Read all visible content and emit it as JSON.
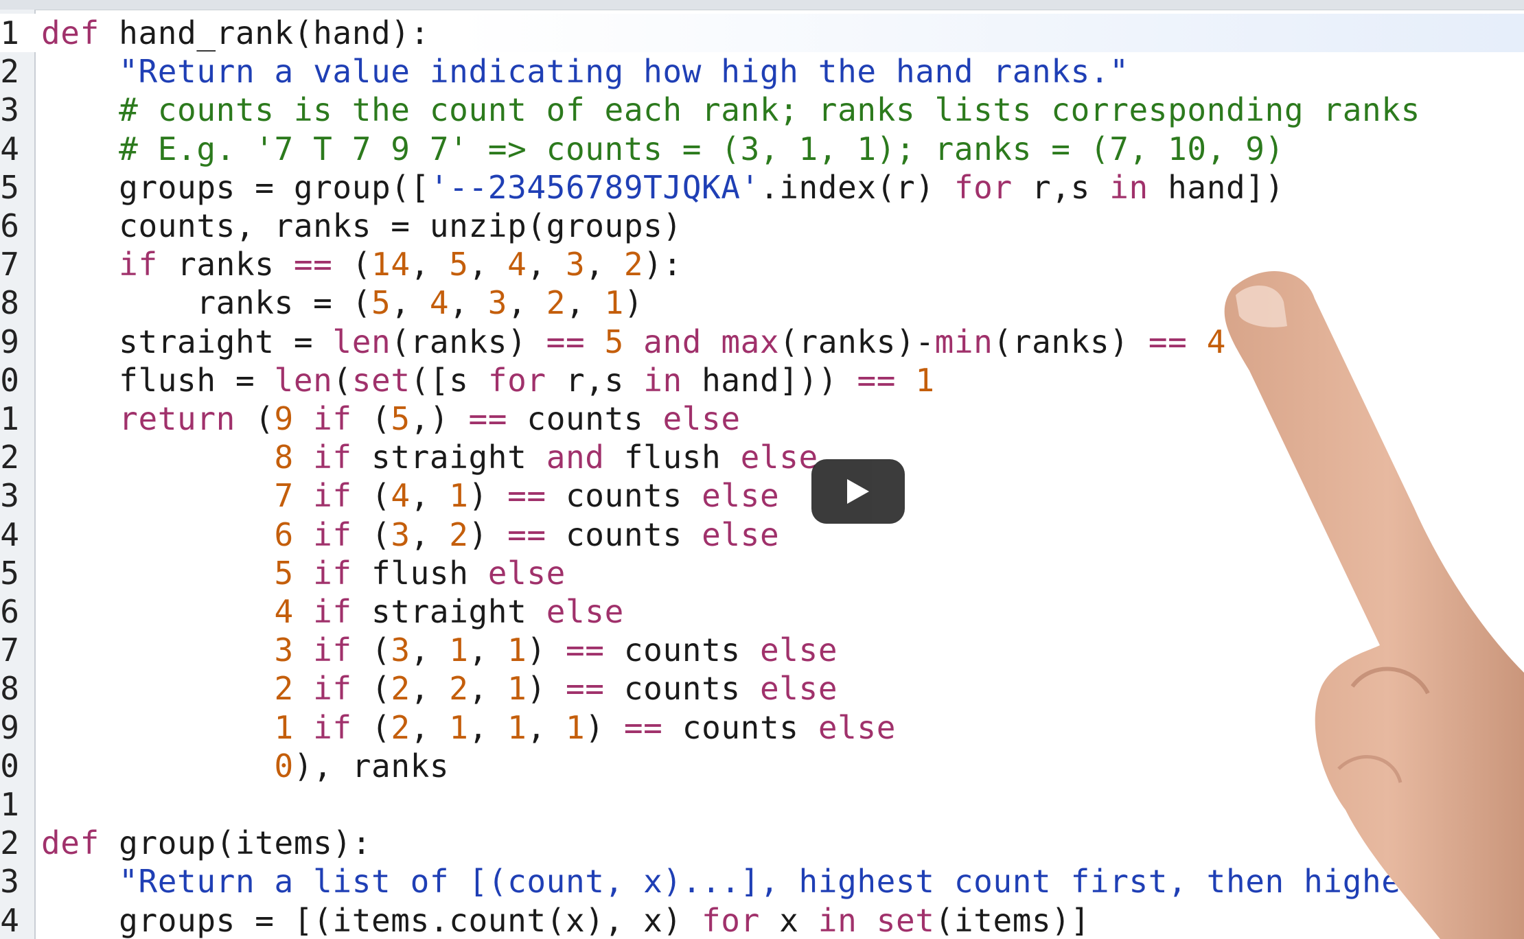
{
  "video": {
    "play_label": "play"
  },
  "colors": {
    "keyword": "#a0316b",
    "string": "#1f3fb5",
    "comment": "#2c7a1d",
    "number": "#c45e0b"
  },
  "lines": [
    {
      "n": "1",
      "tokens": [
        [
          "k",
          "def"
        ],
        [
          "b",
          " hand_rank(hand):"
        ]
      ]
    },
    {
      "n": "2",
      "tokens": [
        [
          "s",
          "    \"Return a value indicating how high the hand ranks.\""
        ]
      ]
    },
    {
      "n": "3",
      "tokens": [
        [
          "c",
          "    # counts is the count of each rank; ranks lists corresponding ranks"
        ]
      ]
    },
    {
      "n": "4",
      "tokens": [
        [
          "c",
          "    # E.g. '7 T 7 9 7' => counts = (3, 1, 1); ranks = (7, 10, 9)"
        ]
      ]
    },
    {
      "n": "5",
      "tokens": [
        [
          "b",
          "    groups = group(["
        ],
        [
          "s",
          "'--23456789TJQKA'"
        ],
        [
          "b",
          ".index(r) "
        ],
        [
          "k",
          "for"
        ],
        [
          "b",
          " r,s "
        ],
        [
          "k",
          "in"
        ],
        [
          "b",
          " hand])"
        ]
      ]
    },
    {
      "n": "6",
      "tokens": [
        [
          "b",
          "    counts, ranks = unzip(groups)"
        ]
      ]
    },
    {
      "n": "7",
      "tokens": [
        [
          "k",
          "    if"
        ],
        [
          "b",
          " ranks "
        ],
        [
          "o",
          "=="
        ],
        [
          "b",
          " ("
        ],
        [
          "n",
          "14"
        ],
        [
          "b",
          ", "
        ],
        [
          "n",
          "5"
        ],
        [
          "b",
          ", "
        ],
        [
          "n",
          "4"
        ],
        [
          "b",
          ", "
        ],
        [
          "n",
          "3"
        ],
        [
          "b",
          ", "
        ],
        [
          "n",
          "2"
        ],
        [
          "b",
          "):"
        ]
      ]
    },
    {
      "n": "8",
      "tokens": [
        [
          "b",
          "        ranks = ("
        ],
        [
          "n",
          "5"
        ],
        [
          "b",
          ", "
        ],
        [
          "n",
          "4"
        ],
        [
          "b",
          ", "
        ],
        [
          "n",
          "3"
        ],
        [
          "b",
          ", "
        ],
        [
          "n",
          "2"
        ],
        [
          "b",
          ", "
        ],
        [
          "n",
          "1"
        ],
        [
          "b",
          ")"
        ]
      ]
    },
    {
      "n": "9",
      "tokens": [
        [
          "b",
          "    straight = "
        ],
        [
          "k",
          "len"
        ],
        [
          "b",
          "(ranks) "
        ],
        [
          "o",
          "=="
        ],
        [
          "b",
          " "
        ],
        [
          "n",
          "5"
        ],
        [
          "b",
          " "
        ],
        [
          "k",
          "and"
        ],
        [
          "b",
          " "
        ],
        [
          "k",
          "max"
        ],
        [
          "b",
          "(ranks)-"
        ],
        [
          "k",
          "min"
        ],
        [
          "b",
          "(ranks) "
        ],
        [
          "o",
          "=="
        ],
        [
          "b",
          " "
        ],
        [
          "n",
          "4"
        ]
      ]
    },
    {
      "n": "0",
      "tokens": [
        [
          "b",
          "    flush = "
        ],
        [
          "k",
          "len"
        ],
        [
          "b",
          "("
        ],
        [
          "k",
          "set"
        ],
        [
          "b",
          "([s "
        ],
        [
          "k",
          "for"
        ],
        [
          "b",
          " r,s "
        ],
        [
          "k",
          "in"
        ],
        [
          "b",
          " hand])) "
        ],
        [
          "o",
          "=="
        ],
        [
          "b",
          " "
        ],
        [
          "n",
          "1"
        ]
      ]
    },
    {
      "n": "1",
      "tokens": [
        [
          "k",
          "    return"
        ],
        [
          "b",
          " ("
        ],
        [
          "n",
          "9"
        ],
        [
          "b",
          " "
        ],
        [
          "k",
          "if"
        ],
        [
          "b",
          " ("
        ],
        [
          "n",
          "5"
        ],
        [
          "b",
          ",) "
        ],
        [
          "o",
          "=="
        ],
        [
          "b",
          " counts "
        ],
        [
          "k",
          "else"
        ]
      ]
    },
    {
      "n": "2",
      "tokens": [
        [
          "b",
          "            "
        ],
        [
          "n",
          "8"
        ],
        [
          "b",
          " "
        ],
        [
          "k",
          "if"
        ],
        [
          "b",
          " straight "
        ],
        [
          "k",
          "and"
        ],
        [
          "b",
          " flush "
        ],
        [
          "k",
          "else"
        ]
      ]
    },
    {
      "n": "3",
      "tokens": [
        [
          "b",
          "            "
        ],
        [
          "n",
          "7"
        ],
        [
          "b",
          " "
        ],
        [
          "k",
          "if"
        ],
        [
          "b",
          " ("
        ],
        [
          "n",
          "4"
        ],
        [
          "b",
          ", "
        ],
        [
          "n",
          "1"
        ],
        [
          "b",
          ") "
        ],
        [
          "o",
          "=="
        ],
        [
          "b",
          " counts "
        ],
        [
          "k",
          "else"
        ]
      ]
    },
    {
      "n": "4",
      "tokens": [
        [
          "b",
          "            "
        ],
        [
          "n",
          "6"
        ],
        [
          "b",
          " "
        ],
        [
          "k",
          "if"
        ],
        [
          "b",
          " ("
        ],
        [
          "n",
          "3"
        ],
        [
          "b",
          ", "
        ],
        [
          "n",
          "2"
        ],
        [
          "b",
          ") "
        ],
        [
          "o",
          "=="
        ],
        [
          "b",
          " counts "
        ],
        [
          "k",
          "else"
        ]
      ]
    },
    {
      "n": "5",
      "tokens": [
        [
          "b",
          "            "
        ],
        [
          "n",
          "5"
        ],
        [
          "b",
          " "
        ],
        [
          "k",
          "if"
        ],
        [
          "b",
          " flush "
        ],
        [
          "k",
          "else"
        ]
      ]
    },
    {
      "n": "6",
      "tokens": [
        [
          "b",
          "            "
        ],
        [
          "n",
          "4"
        ],
        [
          "b",
          " "
        ],
        [
          "k",
          "if"
        ],
        [
          "b",
          " straight "
        ],
        [
          "k",
          "else"
        ]
      ]
    },
    {
      "n": "7",
      "tokens": [
        [
          "b",
          "            "
        ],
        [
          "n",
          "3"
        ],
        [
          "b",
          " "
        ],
        [
          "k",
          "if"
        ],
        [
          "b",
          " ("
        ],
        [
          "n",
          "3"
        ],
        [
          "b",
          ", "
        ],
        [
          "n",
          "1"
        ],
        [
          "b",
          ", "
        ],
        [
          "n",
          "1"
        ],
        [
          "b",
          ") "
        ],
        [
          "o",
          "=="
        ],
        [
          "b",
          " counts "
        ],
        [
          "k",
          "else"
        ]
      ]
    },
    {
      "n": "8",
      "tokens": [
        [
          "b",
          "            "
        ],
        [
          "n",
          "2"
        ],
        [
          "b",
          " "
        ],
        [
          "k",
          "if"
        ],
        [
          "b",
          " ("
        ],
        [
          "n",
          "2"
        ],
        [
          "b",
          ", "
        ],
        [
          "n",
          "2"
        ],
        [
          "b",
          ", "
        ],
        [
          "n",
          "1"
        ],
        [
          "b",
          ") "
        ],
        [
          "o",
          "=="
        ],
        [
          "b",
          " counts "
        ],
        [
          "k",
          "else"
        ]
      ]
    },
    {
      "n": "9",
      "tokens": [
        [
          "b",
          "            "
        ],
        [
          "n",
          "1"
        ],
        [
          "b",
          " "
        ],
        [
          "k",
          "if"
        ],
        [
          "b",
          " ("
        ],
        [
          "n",
          "2"
        ],
        [
          "b",
          ", "
        ],
        [
          "n",
          "1"
        ],
        [
          "b",
          ", "
        ],
        [
          "n",
          "1"
        ],
        [
          "b",
          ", "
        ],
        [
          "n",
          "1"
        ],
        [
          "b",
          ") "
        ],
        [
          "o",
          "=="
        ],
        [
          "b",
          " counts "
        ],
        [
          "k",
          "else"
        ]
      ]
    },
    {
      "n": "0",
      "tokens": [
        [
          "b",
          "            "
        ],
        [
          "n",
          "0"
        ],
        [
          "b",
          "), ranks"
        ]
      ]
    },
    {
      "n": "1",
      "tokens": [
        [
          "b",
          ""
        ]
      ]
    },
    {
      "n": "2",
      "tokens": [
        [
          "k",
          "def"
        ],
        [
          "b",
          " group(items):"
        ]
      ]
    },
    {
      "n": "3",
      "tokens": [
        [
          "s",
          "    \"Return a list of [(count, x)...], highest count first, then highest x first.\""
        ]
      ]
    },
    {
      "n": "4",
      "tokens": [
        [
          "b",
          "    groups = [(items.count(x), x) "
        ],
        [
          "k",
          "for"
        ],
        [
          "b",
          " x "
        ],
        [
          "k",
          "in"
        ],
        [
          "b",
          " "
        ],
        [
          "k",
          "set"
        ],
        [
          "b",
          "(items)]"
        ]
      ]
    }
  ]
}
